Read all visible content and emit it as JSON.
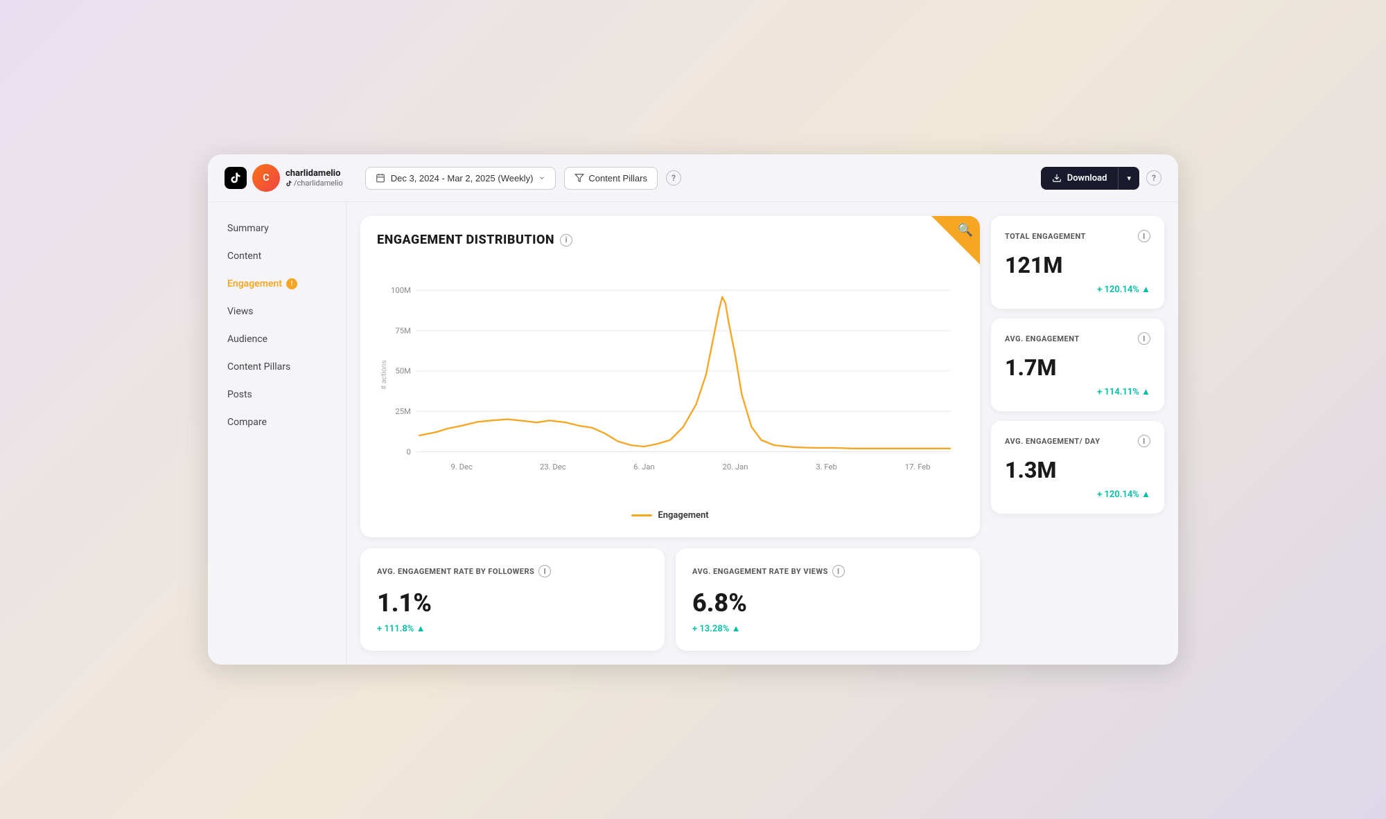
{
  "user": {
    "name": "charlidamelio",
    "handle": "/charlidamelio",
    "avatar_initials": "C"
  },
  "header": {
    "date_range": "Dec 3, 2024 - Mar 2, 2025 (Weekly)",
    "content_pillars_label": "Content Pillars",
    "download_label": "Download",
    "help_label": "?"
  },
  "sidebar": {
    "items": [
      {
        "label": "Summary",
        "active": false
      },
      {
        "label": "Content",
        "active": false
      },
      {
        "label": "Engagement",
        "active": true,
        "badge": true
      },
      {
        "label": "Views",
        "active": false
      },
      {
        "label": "Audience",
        "active": false
      },
      {
        "label": "Content Pillars",
        "active": false
      },
      {
        "label": "Posts",
        "active": false
      },
      {
        "label": "Compare",
        "active": false
      }
    ]
  },
  "chart": {
    "title": "ENGAGEMENT DISTRIBUTION",
    "y_label": "# actions",
    "legend": "Engagement",
    "x_labels": [
      "9. Dec",
      "23. Dec",
      "6. Jan",
      "20. Jan",
      "3. Feb",
      "17. Feb"
    ],
    "y_labels": [
      "100M",
      "75M",
      "50M",
      "25M",
      "0"
    ]
  },
  "metrics": [
    {
      "title": "TOTAL ENGAGEMENT",
      "value": "121M",
      "change": "+ 120.14% ▲"
    },
    {
      "title": "AVG. ENGAGEMENT",
      "value": "1.7M",
      "change": "+ 114.11% ▲"
    },
    {
      "title": "AVG. ENGAGEMENT/ DAY",
      "value": "1.3M",
      "change": "+ 120.14% ▲"
    }
  ],
  "bottom_cards": [
    {
      "title": "AVG. ENGAGEMENT RATE BY FOLLOWERS",
      "value": "1.1%",
      "change": "+ 111.8% ▲"
    },
    {
      "title": "AVG. ENGAGEMENT RATE BY VIEWS",
      "value": "6.8%",
      "change": "+ 13.28% ▲"
    }
  ]
}
